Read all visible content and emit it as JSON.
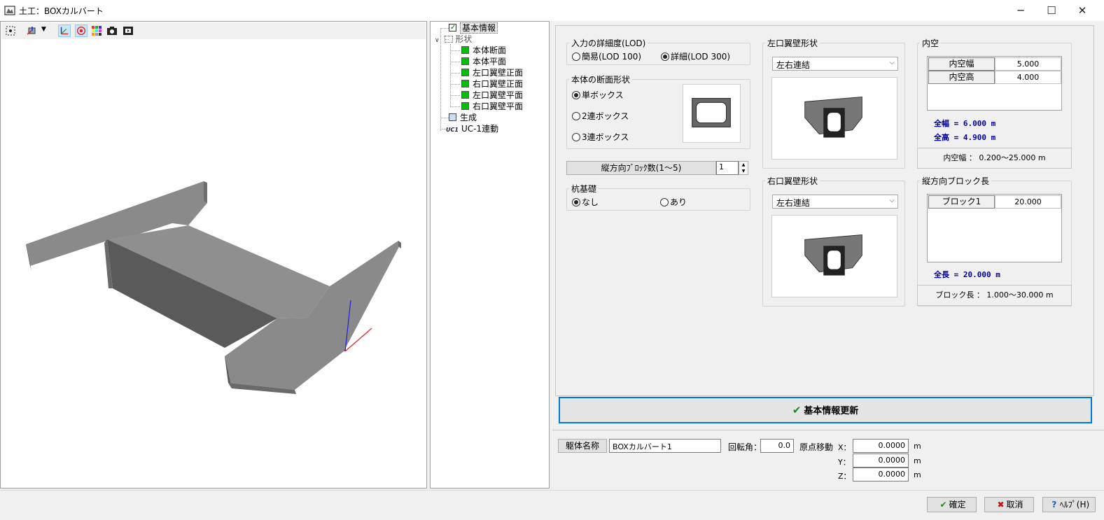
{
  "window": {
    "title": "土工：BOXカルバート",
    "minimize_glyph": "─",
    "maximize_glyph": "☐",
    "close_glyph": "✕"
  },
  "toolbar": {
    "icons": [
      "fit-view-icon",
      "view-rotate-icon",
      "dropdown-arrow-icon",
      "axis-icon",
      "target-icon",
      "color-palette-icon",
      "camera-icon",
      "film-icon"
    ]
  },
  "tree": {
    "items": [
      {
        "label": "基本情報",
        "level": 1,
        "checked": true,
        "selected": true
      },
      {
        "label": "形状",
        "level": 1,
        "expanded": true
      },
      {
        "label": "本体断面",
        "level": 2,
        "checked": true
      },
      {
        "label": "本体平面",
        "level": 2,
        "checked": true
      },
      {
        "label": "左口翼壁正面",
        "level": 2,
        "checked": true
      },
      {
        "label": "右口翼壁正面",
        "level": 2,
        "checked": true
      },
      {
        "label": "左口翼壁平面",
        "level": 2,
        "checked": true
      },
      {
        "label": "右口翼壁平面",
        "level": 2,
        "checked": true
      },
      {
        "label": "生成",
        "level": 1
      },
      {
        "label": "UC-1連動",
        "level": 1
      }
    ],
    "uc_icon_text": "UC1"
  },
  "lod": {
    "label": "入力の詳細度(LOD)",
    "option1": "簡易(LOD 100)",
    "option2": "詳細(LOD 300)",
    "selected": 2
  },
  "section": {
    "label": "本体の断面形状",
    "options": [
      "単ボックス",
      "2連ボックス",
      "3連ボックス"
    ],
    "selected": 0
  },
  "blocks": {
    "label": "縦方向ﾌﾞﾛｯｸ数(1～5)",
    "value": "1"
  },
  "pile": {
    "label": "杭基礎",
    "option1": "なし",
    "option2": "あり",
    "selected": 1
  },
  "left_wing": {
    "label": "左口翼壁形状",
    "value": "左右連結"
  },
  "right_wing": {
    "label": "右口翼壁形状",
    "value": "左右連結"
  },
  "inner": {
    "label": "内空",
    "rows": [
      {
        "name": "内空幅",
        "value": "5.000"
      },
      {
        "name": "内空高",
        "value": "4.000"
      }
    ],
    "total_width": "全幅 = 6.000 m",
    "total_height": "全高 = 4.900 m",
    "range": "内空幅 ： 0.200～25.000 m"
  },
  "block_len": {
    "label": "縦方向ブロック長",
    "rows": [
      {
        "name": "ブロック1",
        "value": "20.000"
      }
    ],
    "total": "全長 = 20.000 m",
    "range": "ブロック長 ： 1.000～30.000 m"
  },
  "update_button": "基本情報更新",
  "bottom": {
    "name_label": "躯体名称",
    "name_value": "BOXカルバート1",
    "rotation_label": "回転角：",
    "rotation_value": "0.0",
    "origin_label": "原点移動",
    "x_label": "X：",
    "y_label": "Y：",
    "z_label": "Z：",
    "x_value": "0.0000",
    "y_value": "0.0000",
    "z_value": "0.0000",
    "unit": "m"
  },
  "footer": {
    "ok": "確定",
    "cancel": "取消",
    "help": "ﾍﾙﾌﾟ(H)"
  },
  "colors": {
    "accent": "#0078d7",
    "check_green": "#00c000",
    "info_blue": "#0000a0",
    "axis_red": "#e02020",
    "axis_blue": "#2020e0"
  }
}
